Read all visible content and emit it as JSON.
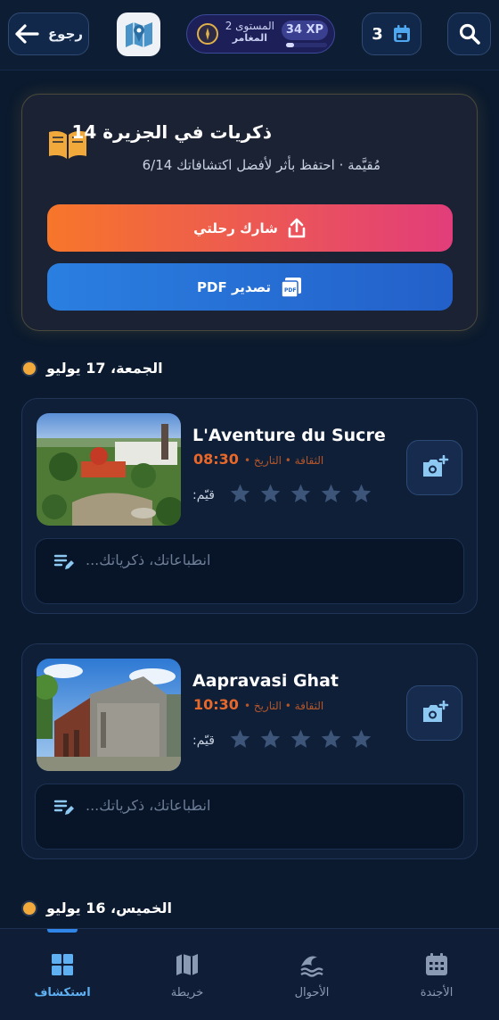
{
  "header": {
    "back_label": "رجوع",
    "xp_label": "34 XP",
    "xp_progress": 0.2,
    "level_label": "المستوى 2",
    "rank_label": "المغامر",
    "calendar_count": "3"
  },
  "memories": {
    "title": "ذكريات في الجزيرة 14",
    "subtitle": "مُقيَّمة · احتفظ بأثر لأفضل اكتشافاتك 6/14",
    "share_label": "شارك رحلتي",
    "pdf_label": "تصدير PDF"
  },
  "days": [
    {
      "date_label": "الجمعة، 17 يوليو",
      "places": [
        {
          "name": "L'Aventure du Sucre",
          "category": "الثقافة • التاريخ •",
          "time": "08:30",
          "rate_label": "قيّم:",
          "rating": 0,
          "note_placeholder": "انطباعاتك، ذكرياتك..."
        },
        {
          "name": "Aapravasi Ghat",
          "category": "الثقافة • التاريخ •",
          "time": "10:30",
          "rate_label": "قيّم:",
          "rating": 0,
          "note_placeholder": "انطباعاتك، ذكرياتك..."
        }
      ]
    },
    {
      "date_label": "الخميس، 16 يوليو",
      "places": []
    }
  ],
  "nav": {
    "items": [
      {
        "label": "استكشاف",
        "icon": "grid-icon",
        "active": true
      },
      {
        "label": "خريطة",
        "icon": "map-icon",
        "active": false
      },
      {
        "label": "الأحوال",
        "icon": "waves-icon",
        "active": false
      },
      {
        "label": "الأجندة",
        "icon": "calendar-icon",
        "active": false
      }
    ]
  },
  "colors": {
    "accent": "#2f86e8",
    "gold": "#f2a93b",
    "time_orange": "#e8682a"
  }
}
